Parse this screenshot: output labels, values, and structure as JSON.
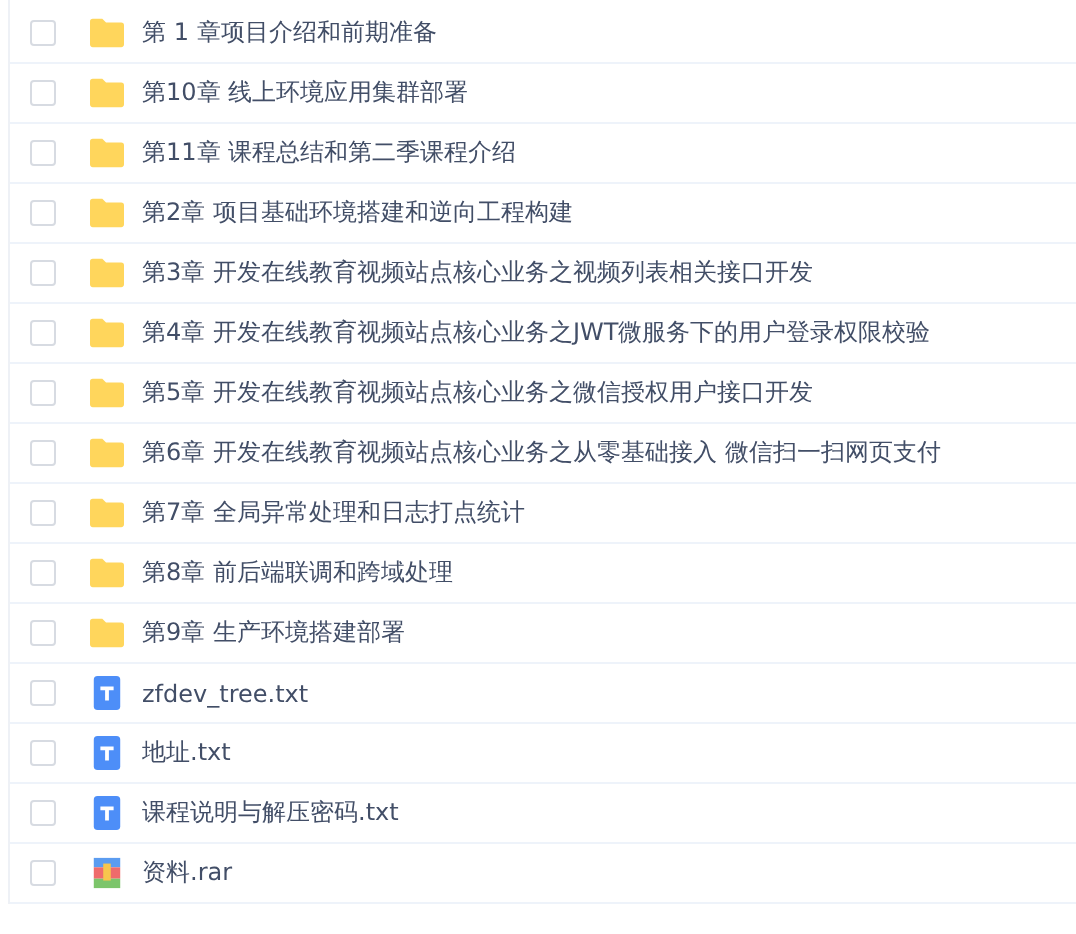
{
  "files": [
    {
      "kind": "folder",
      "name": "第 1 章项目介绍和前期准备",
      "checked": false
    },
    {
      "kind": "folder",
      "name": "第10章 线上环境应用集群部署",
      "checked": false
    },
    {
      "kind": "folder",
      "name": "第11章 课程总结和第二季课程介绍",
      "checked": false
    },
    {
      "kind": "folder",
      "name": "第2章 项目基础环境搭建和逆向工程构建",
      "checked": false
    },
    {
      "kind": "folder",
      "name": "第3章 开发在线教育视频站点核心业务之视频列表相关接口开发",
      "checked": false
    },
    {
      "kind": "folder",
      "name": "第4章 开发在线教育视频站点核心业务之JWT微服务下的用户登录权限校验",
      "checked": false
    },
    {
      "kind": "folder",
      "name": "第5章 开发在线教育视频站点核心业务之微信授权用户接口开发",
      "checked": false
    },
    {
      "kind": "folder",
      "name": "第6章 开发在线教育视频站点核心业务之从零基础接入 微信扫一扫网页支付",
      "checked": false
    },
    {
      "kind": "folder",
      "name": "第7章 全局异常处理和日志打点统计",
      "checked": false
    },
    {
      "kind": "folder",
      "name": "第8章 前后端联调和跨域处理",
      "checked": false
    },
    {
      "kind": "folder",
      "name": "第9章 生产环境搭建部署",
      "checked": false
    },
    {
      "kind": "text",
      "name": "zfdev_tree.txt",
      "checked": false
    },
    {
      "kind": "text",
      "name": "地址.txt",
      "checked": false
    },
    {
      "kind": "text",
      "name": "课程说明与解压密码.txt",
      "checked": false
    },
    {
      "kind": "archive",
      "name": "资料.rar",
      "checked": false
    }
  ]
}
